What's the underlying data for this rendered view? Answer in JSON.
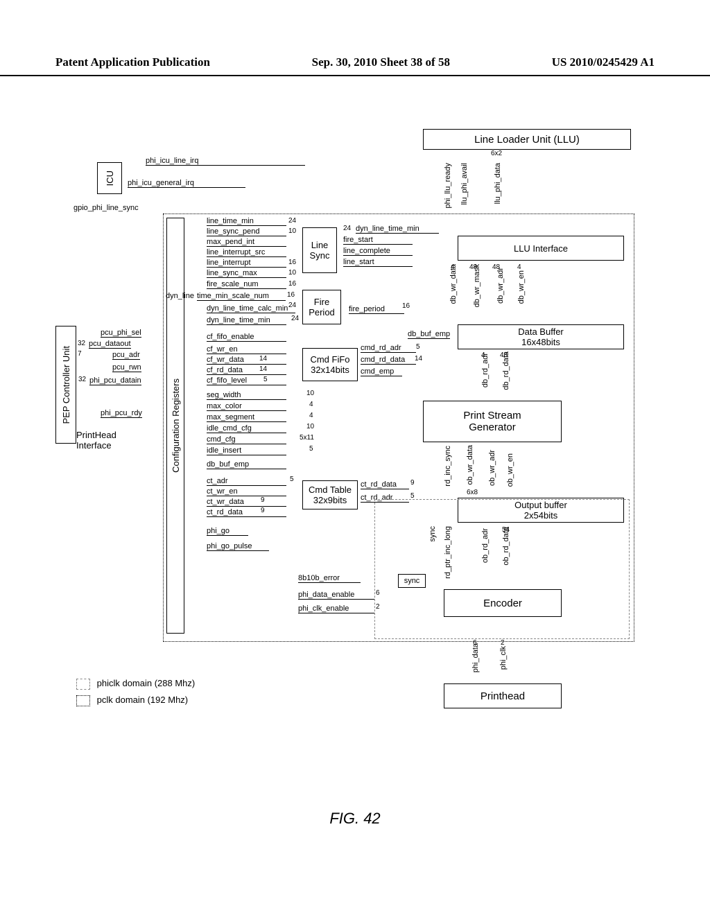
{
  "header": {
    "left": "Patent Application Publication",
    "center": "Sep. 30, 2010  Sheet 38 of 58",
    "right": "US 2010/0245429 A1"
  },
  "figure_caption": "FIG. 42",
  "legend": {
    "phiclk": "phiclk domain (288 Mhz)",
    "pclk": "pclk domain (192 Mhz)"
  },
  "blocks": {
    "icu": "ICU",
    "pep": "PEP Controller Unit",
    "config": "Configuration Registers",
    "llu_title": "Line Loader Unit (LLU)",
    "llu_interface": "LLU Interface",
    "data_buffer": "Data Buffer\n16x48bits",
    "print_stream": "Print Stream\nGenerator",
    "output_buffer": "Output buffer\n2x54bits",
    "encoder": "Encoder",
    "printhead": "Printhead",
    "line_sync": "Line\nSync",
    "fire_period": "Fire\nPeriod",
    "cmd_fifo": "Cmd FiFo\n32x14bits",
    "cmd_table": "Cmd Table\n32x9bits",
    "sync": "sync",
    "printhead_interface": "PrintHead\nInterface"
  },
  "signals": {
    "phi_icu_line_irq": "phi_icu_line_irq",
    "phi_icu_general_irq": "phi_icu_general_irq",
    "gpio_phi_line_sync": "gpio_phi_line_sync",
    "pcu_phi_sel": "pcu_phi_sel",
    "pcu_dataout": "pcu_dataout",
    "pcu_adr": "pcu_adr",
    "pcu_rwn": "pcu_rwn",
    "phi_pcu_datain": "phi_pcu_datain",
    "phi_pcu_rdy": "phi_pcu_rdy",
    "line_time_min": "line_time_min",
    "line_sync_pend": "line_sync_pend",
    "max_pend_int": "max_pend_int",
    "line_interrupt_src": "line_interrupt_src",
    "line_interrupt": "line_interrupt",
    "line_sync_max": "line_sync_max",
    "fire_scale_num": "fire_scale_num",
    "dyn_line_tmsn": "time_min_scale_num",
    "dyn_line_prefix": "dyn_line",
    "dyn_line_time_cm": "dyn_line_time_calc_min",
    "dyn_line_time_min2": "dyn_line_time_min",
    "dyn_line_time_min_r": "dyn_line_time_min",
    "fire_start": "fire_start",
    "line_complete": "line_complete",
    "line_start": "line_start",
    "fire_period": "fire_period",
    "cf_fifo_enable": "cf_fifo_enable",
    "cf_wr_en": "cf_wr_en",
    "cf_wr_data": "cf_wr_data",
    "cf_rd_data": "cf_rd_data",
    "cf_fifo_level": "cf_fifo_level",
    "cmd_rd_adr": "cmd_rd_adr",
    "cmd_rd_data": "cmd_rd_data",
    "cmd_emp": "cmd_emp",
    "seg_width": "seg_width",
    "max_color": "max_color",
    "max_segment": "max_segment",
    "idle_cmd_cfg": "idle_cmd_cfg",
    "cmd_cfg": "cmd_cfg",
    "idle_insert": "idle_insert",
    "db_buf_emp": "db_buf_emp",
    "db_buf_emp2": "db_buf_emp",
    "ct_adr": "ct_adr",
    "ct_wr_en": "ct_wr_en",
    "ct_wr_data": "ct_wr_data",
    "ct_rd_data_l": "ct_rd_data",
    "ct_rd_data": "ct_rd_data",
    "ct_rd_adr": "ct_rd_adr",
    "phi_go": "phi_go",
    "phi_go_pulse": "phi_go_pulse",
    "eightb10b_error": "8b10b_error",
    "phi_data_enable": "phi_data_enable",
    "phi_clk_enable": "phi_clk_enable",
    "phi_llu_ready": "phi_llu_ready",
    "llu_phi_avail": "llu_phi_avail",
    "llu_phi_data": "llu_phi_data",
    "db_wr_data": "db_wr_data",
    "db_wr_mask": "db_wr_mask",
    "db_wr_adr": "db_wr_adr",
    "db_wr_en": "db_wr_en",
    "db_rd_adr": "db_rd_adr",
    "db_rd_data": "db_rd_data",
    "rd_inc_sync": "rd_inc_sync",
    "ob_wr_data": "ob_wr_data",
    "ob_wr_adr": "ob_wr_adr",
    "ob_wr_en": "ob_wr_en",
    "sync_v": "sync",
    "rd_ptr_inc_long": "rd_ptr_inc_long",
    "ob_rd_adr": "ob_rd_adr",
    "ob_rd_data": "ob_rd_data",
    "phi_data": "phi_data",
    "phi_clk": "phi_clk",
    "n24": "24",
    "n10": "10",
    "n16": "16",
    "n16b": "16",
    "n14": "14",
    "n5": "5",
    "n4": "4",
    "n9": "9",
    "n48": "48",
    "n6x2": "6x2",
    "n6x8": "6x8",
    "n54": "54",
    "n32": "32",
    "n7": "7",
    "n6": "6",
    "n2": "2",
    "n5x11": "5x11"
  }
}
